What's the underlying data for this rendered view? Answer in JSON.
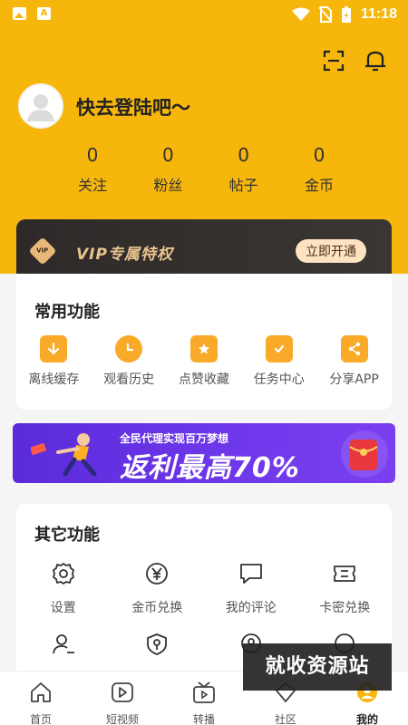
{
  "status_bar": {
    "time": "11:18",
    "left_icons": [
      "image-icon",
      "text-a-icon"
    ],
    "right_icons": [
      "wifi-icon",
      "no-sim-icon",
      "battery-charging-icon"
    ]
  },
  "header": {
    "background_color": "#f7b60c",
    "icons": [
      "scan-icon",
      "bell-icon"
    ]
  },
  "profile": {
    "login_prompt": "快去登陆吧～",
    "stats": [
      {
        "value": "0",
        "label": "关注"
      },
      {
        "value": "0",
        "label": "粉丝"
      },
      {
        "value": "0",
        "label": "帖子"
      },
      {
        "value": "0",
        "label": "金币"
      }
    ]
  },
  "vip": {
    "badge": "VIP",
    "title": "VIP专属特权",
    "button": "立即开通"
  },
  "common_functions": {
    "title": "常用功能",
    "items": [
      {
        "label": "离线缓存",
        "icon": "download-icon"
      },
      {
        "label": "观看历史",
        "icon": "clock-icon"
      },
      {
        "label": "点赞收藏",
        "icon": "star-bookmark-icon"
      },
      {
        "label": "任务中心",
        "icon": "task-clipboard-icon"
      },
      {
        "label": "分享APP",
        "icon": "share-icon"
      }
    ]
  },
  "banner": {
    "subtitle": "全民代理实现百万梦想",
    "headline": "返利最高70%"
  },
  "other_functions": {
    "title": "其它功能",
    "items": [
      {
        "label": "设置",
        "icon": "gear-icon"
      },
      {
        "label": "金币兑换",
        "icon": "yen-coin-icon"
      },
      {
        "label": "我的评论",
        "icon": "comment-icon"
      },
      {
        "label": "卡密兑换",
        "icon": "ticket-icon"
      }
    ],
    "row2_icons": [
      "user-edit-icon",
      "shield-icon",
      "location-icon",
      "circle-icon"
    ]
  },
  "tabbar": {
    "tabs": [
      {
        "label": "首页",
        "icon": "home-icon"
      },
      {
        "label": "短视频",
        "icon": "video-icon"
      },
      {
        "label": "转播",
        "icon": "broadcast-icon"
      },
      {
        "label": "社区",
        "icon": "community-icon"
      },
      {
        "label": "我的",
        "icon": "profile-icon",
        "active": true
      }
    ]
  },
  "watermark": "就收资源站"
}
